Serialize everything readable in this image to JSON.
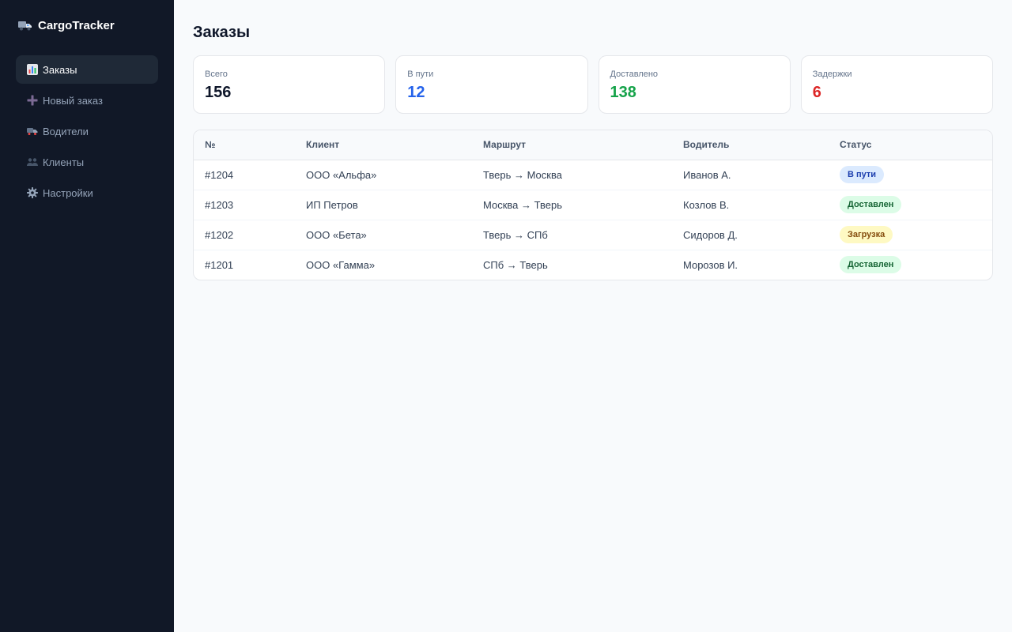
{
  "app": {
    "name": "CargoTracker"
  },
  "sidebar": {
    "items": [
      {
        "label": "Заказы",
        "icon": "bar-chart-icon",
        "active": true
      },
      {
        "label": "Новый заказ",
        "icon": "plus-icon",
        "active": false
      },
      {
        "label": "Водители",
        "icon": "truck-icon",
        "active": false
      },
      {
        "label": "Клиенты",
        "icon": "people-icon",
        "active": false
      },
      {
        "label": "Настройки",
        "icon": "gear-icon",
        "active": false
      }
    ]
  },
  "page": {
    "title": "Заказы"
  },
  "stats": [
    {
      "label": "Всего",
      "value": "156",
      "color": "#0f172a"
    },
    {
      "label": "В пути",
      "value": "12",
      "color": "#2563eb"
    },
    {
      "label": "Доставлено",
      "value": "138",
      "color": "#16a34a"
    },
    {
      "label": "Задержки",
      "value": "6",
      "color": "#dc2626"
    }
  ],
  "table": {
    "columns": [
      "№",
      "Клиент",
      "Маршрут",
      "Водитель",
      "Статус"
    ],
    "rows": [
      {
        "id": "#1204",
        "client": "ООО «Альфа»",
        "route": "Тверь → Москва",
        "driver": "Иванов А.",
        "status": "В пути",
        "status_type": "transit"
      },
      {
        "id": "#1203",
        "client": "ИП Петров",
        "route": "Москва → Тверь",
        "driver": "Козлов В.",
        "status": "Доставлен",
        "status_type": "delivered"
      },
      {
        "id": "#1202",
        "client": "ООО «Бета»",
        "route": "Тверь → СПб",
        "driver": "Сидоров Д.",
        "status": "Загрузка",
        "status_type": "loading"
      },
      {
        "id": "#1201",
        "client": "ООО «Гамма»",
        "route": "СПб → Тверь",
        "driver": "Морозов И.",
        "status": "Доставлен",
        "status_type": "delivered"
      }
    ]
  }
}
